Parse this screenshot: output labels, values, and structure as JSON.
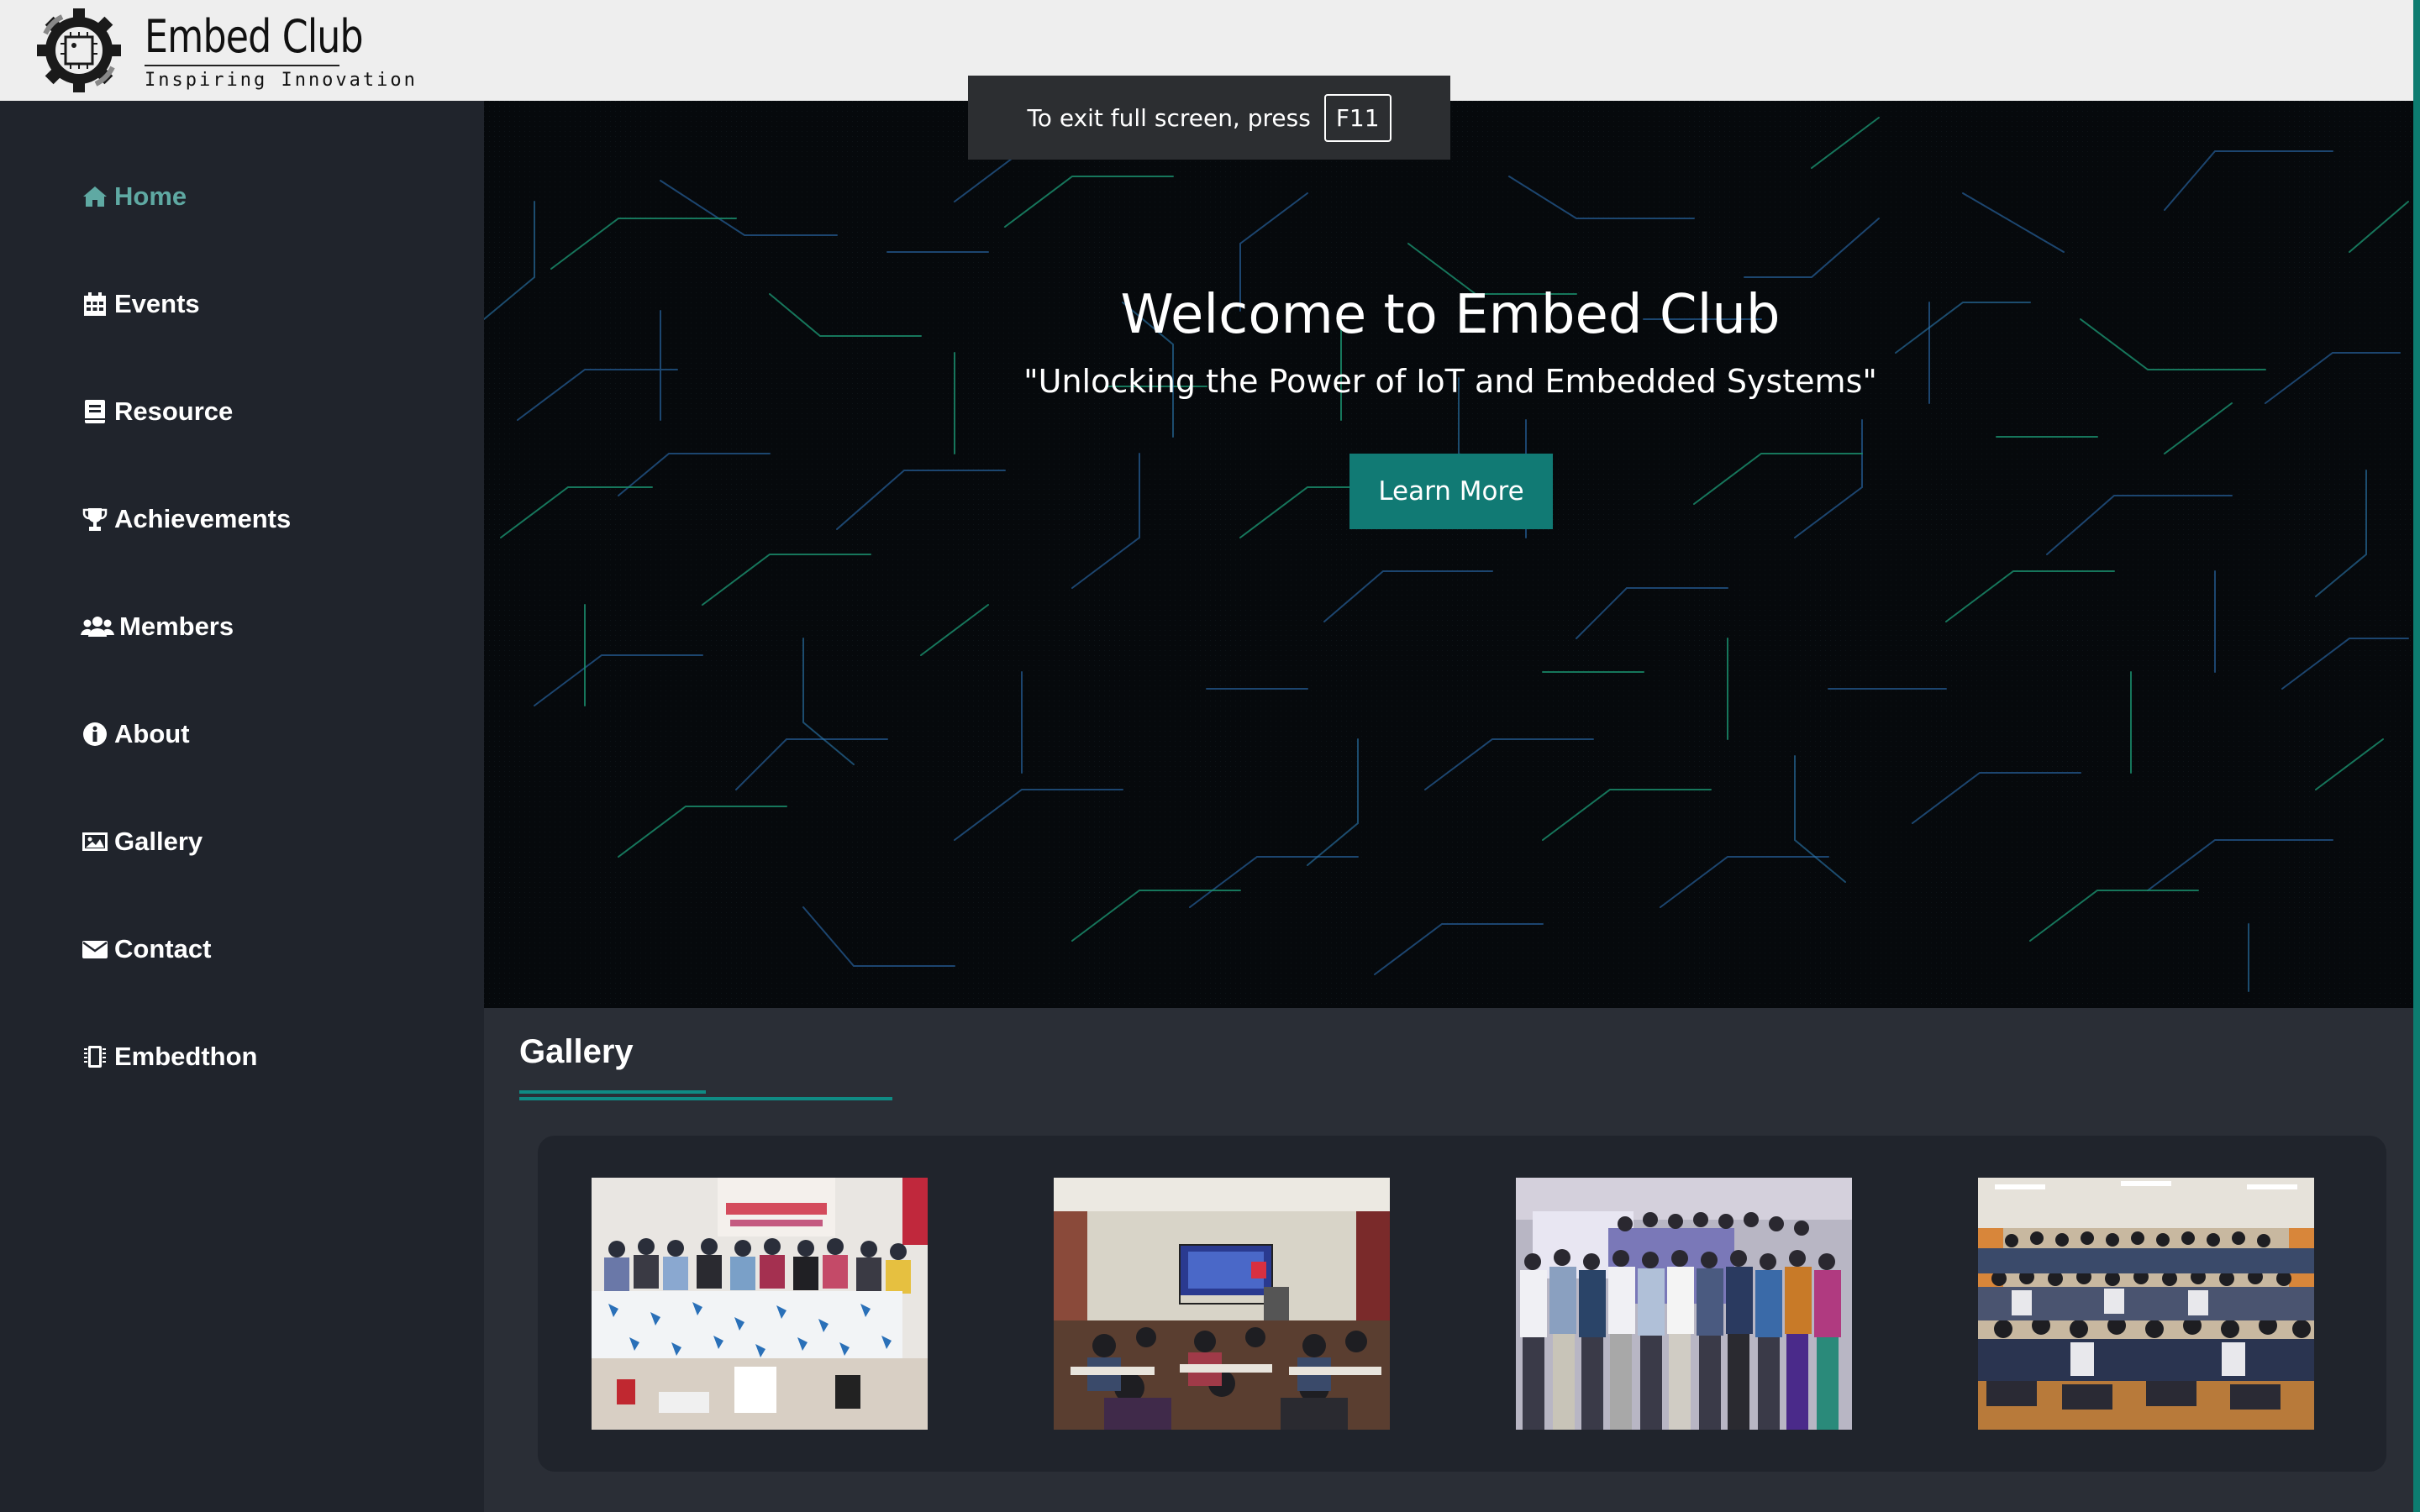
{
  "header": {
    "logo_title": "Embed Club",
    "logo_tagline": "Inspiring Innovation"
  },
  "sidebar": {
    "items": [
      {
        "label": "Home",
        "icon": "home-icon",
        "active": true
      },
      {
        "label": "Events",
        "icon": "calendar-icon"
      },
      {
        "label": "Resource",
        "icon": "book-icon"
      },
      {
        "label": "Achievements",
        "icon": "trophy-icon"
      },
      {
        "label": "Members",
        "icon": "users-icon"
      },
      {
        "label": "About",
        "icon": "info-icon"
      },
      {
        "label": "Gallery",
        "icon": "image-icon"
      },
      {
        "label": "Contact",
        "icon": "envelope-icon"
      },
      {
        "label": "Embedthon",
        "icon": "chip-icon"
      }
    ]
  },
  "hero": {
    "title": "Welcome to Embed Club",
    "subtitle": "\"Unlocking the Power of IoT and Embedded Systems\"",
    "cta_label": "Learn More"
  },
  "fullscreen_notice": {
    "text": "To exit full screen, press",
    "key": "F11"
  },
  "gallery": {
    "heading": "Gallery",
    "photos": [
      "group-photo-event-banner",
      "classroom-presentation",
      "group-photo-standing",
      "large-group-photo"
    ]
  },
  "colors": {
    "accent": "#117a74",
    "active_nav": "#5fa9a3",
    "sidebar_bg": "#20242c",
    "content_bg": "#2a2e36",
    "header_bg": "#eeeeee"
  }
}
